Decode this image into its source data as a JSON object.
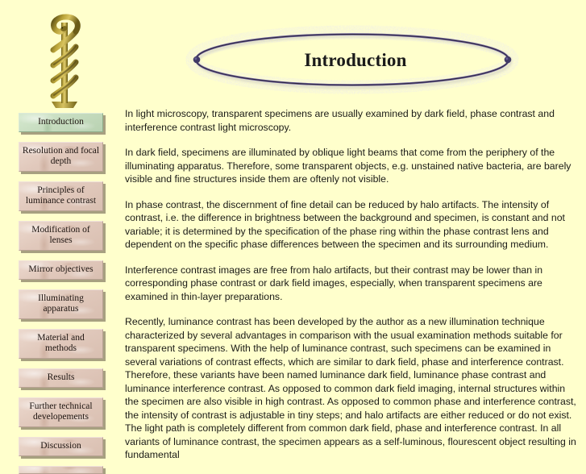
{
  "page": {
    "background_color": "#ffffcc",
    "title": "Introduction"
  },
  "logo": {
    "name": "rod-of-asclepius",
    "alt": "Rod of Asclepius: snake coiled around a golden staff",
    "colors": {
      "staff": "#b9a33a",
      "staff_dark": "#6d5e18",
      "snake": "#8d7a22"
    }
  },
  "banner": {
    "title": "Introduction",
    "ellipse_stroke": "#6b5f9b",
    "ellipse_glow": "#cfcde4",
    "dot_color": "#413a66"
  },
  "sidebar": {
    "items": [
      {
        "label": "Introduction",
        "active": true
      },
      {
        "label": "Resolution and focal depth",
        "active": false
      },
      {
        "label": "Principles of luminance contrast",
        "active": false
      },
      {
        "label": "Modification of lenses",
        "active": false
      },
      {
        "label": "Mirror objectives",
        "active": false
      },
      {
        "label": "Illuminating apparatus",
        "active": false
      },
      {
        "label": "Material and methods",
        "active": false
      },
      {
        "label": "Results",
        "active": false
      },
      {
        "label": "Further technical developements",
        "active": false
      },
      {
        "label": "Discussion",
        "active": false
      },
      {
        "label": "",
        "active": false,
        "partial": true
      }
    ],
    "active_color": "#c7ddc2",
    "inactive_color": "#e3cdc1"
  },
  "content": {
    "paragraphs": [
      "In light microscopy, transparent specimens are usually examined by dark field, phase contrast and interference contrast light microscopy.",
      "In dark field, specimens are illuminated by oblique light beams that come from the periphery of the illuminating apparatus. Therefore, some transparent objects, e.g. unstained native bacteria, are barely visible and fine structures inside them are oftenly not visible.",
      "In phase contrast, the discernment of fine detail can be reduced by halo artifacts. The intensity of contrast, i.e. the difference in brightness between the background and specimen, is constant and not variable; it is determined by the specification of the phase ring within the phase contrast lens and dependent on the specific phase differences between the specimen and its surrounding medium.",
      "Interference contrast images are free from halo artifacts, but their contrast may be lower than in corresponding phase contrast or dark field images, especially, when transparent specimens are examined in thin-layer preparations.",
      "Recently, luminance contrast has been developed by the author as a new illumination technique characterized by several advantages in comparison with the usual examination methods suitable for transparent specimens. With the help of luminance contrast, such specimens can be examined in several variations of contrast effects, which are similar to dark field, phase and interference contrast. Therefore, these variants have been named luminance dark field, luminance phase contrast and luminance interference contrast. As opposed to common dark field imaging, internal structures within the specimen are also visible in high contrast. As opposed to common phase and interference contrast, the intensity of contrast is adjustable in tiny steps; and halo artifacts are either reduced or do not exist. The light path is completely different from common dark field, phase and interference contrast. In all variants of luminance contrast, the specimen appears as a self-luminous, flourescent object resulting in fundamental"
    ]
  }
}
